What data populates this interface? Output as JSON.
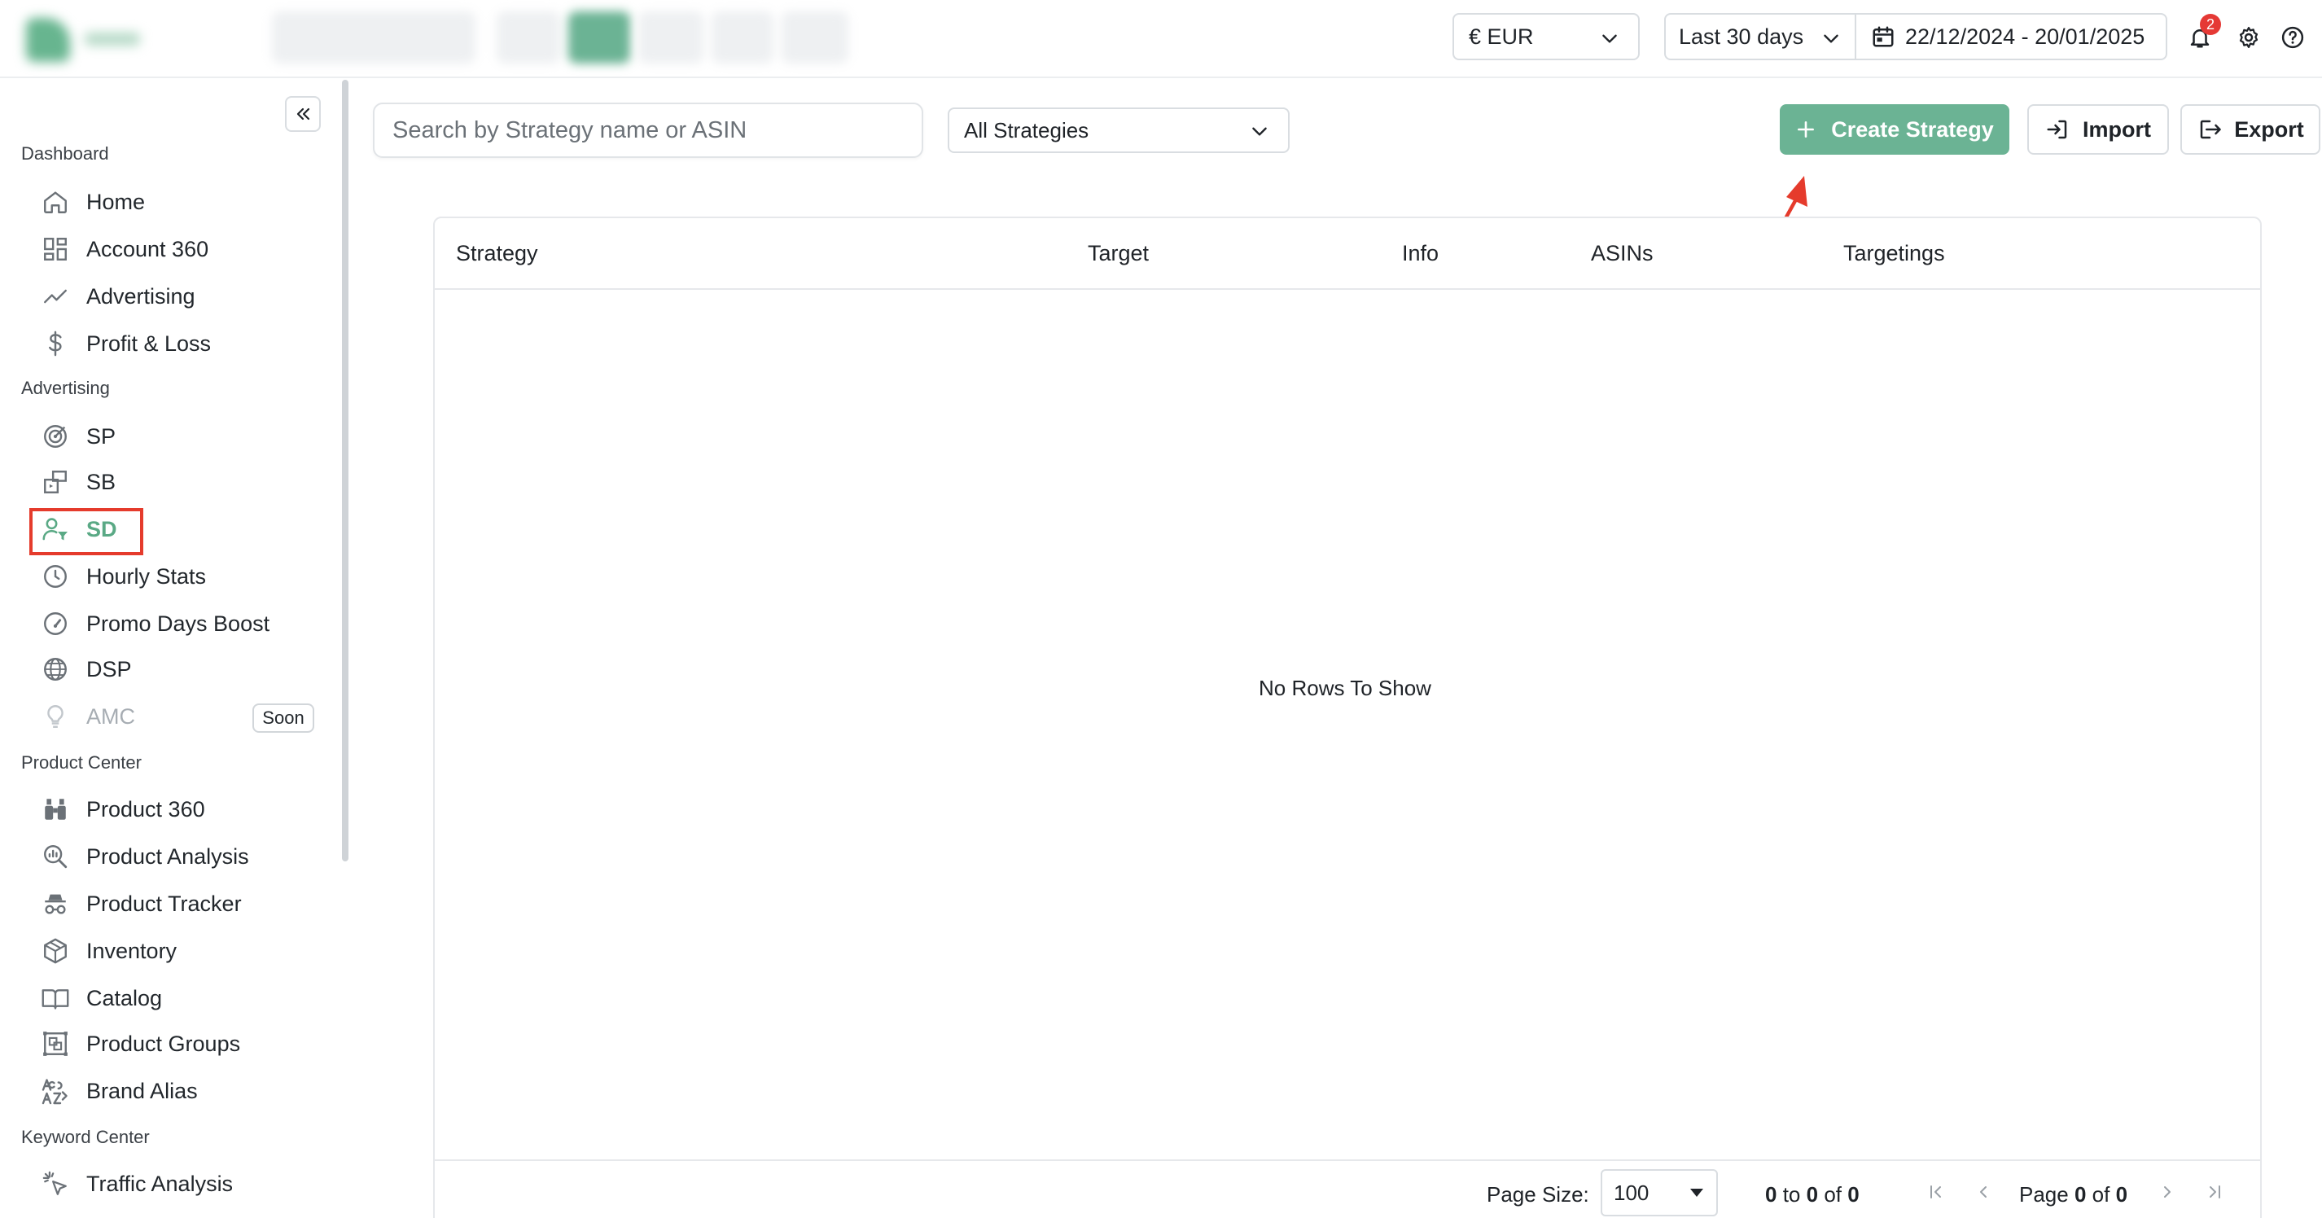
{
  "topbar": {
    "currency": "€ EUR",
    "date_range_preset": "Last 30 days",
    "date_range": "22/12/2024 - 20/01/2025",
    "notification_count": "2"
  },
  "sidebar": {
    "sections": [
      {
        "title": "Dashboard",
        "items": [
          {
            "label": "Home",
            "icon": "home-icon"
          },
          {
            "label": "Account 360",
            "icon": "dashboard-grid-icon"
          },
          {
            "label": "Advertising",
            "icon": "trend-line-icon"
          },
          {
            "label": "Profit & Loss",
            "icon": "dollar-icon"
          }
        ]
      },
      {
        "title": "Advertising",
        "items": [
          {
            "label": "SP",
            "icon": "target-icon"
          },
          {
            "label": "SB",
            "icon": "brand-banner-icon"
          },
          {
            "label": "SD",
            "icon": "user-filter-icon",
            "active": true
          },
          {
            "label": "Hourly Stats",
            "icon": "clock-icon"
          },
          {
            "label": "Promo Days Boost",
            "icon": "gauge-icon"
          },
          {
            "label": "DSP",
            "icon": "globe-icon"
          },
          {
            "label": "AMC",
            "icon": "lightbulb-icon",
            "disabled": true,
            "badge": "Soon"
          }
        ]
      },
      {
        "title": "Product Center",
        "items": [
          {
            "label": "Product 360",
            "icon": "binoculars-icon"
          },
          {
            "label": "Product Analysis",
            "icon": "magnifier-chart-icon"
          },
          {
            "label": "Product Tracker",
            "icon": "spy-icon"
          },
          {
            "label": "Inventory",
            "icon": "box-icon"
          },
          {
            "label": "Catalog",
            "icon": "book-icon"
          },
          {
            "label": "Product Groups",
            "icon": "group-icon"
          },
          {
            "label": "Brand Alias",
            "icon": "text-alias-icon"
          }
        ]
      },
      {
        "title": "Keyword Center",
        "items": [
          {
            "label": "Traffic Analysis",
            "icon": "sparkle-cursor-icon"
          }
        ]
      }
    ]
  },
  "toolbar": {
    "search_placeholder": "Search by Strategy name or ASIN",
    "strategy_filter": "All Strategies",
    "create_label": "Create Strategy",
    "import_label": "Import",
    "export_label": "Export"
  },
  "grid": {
    "columns": [
      "Strategy",
      "Target",
      "Info",
      "ASINs",
      "Targetings"
    ],
    "empty_message": "No Rows To Show",
    "footer": {
      "page_size_label": "Page Size:",
      "page_size": "100",
      "range_from": "0",
      "range_to_label": "to",
      "range_to": "0",
      "range_of_label": "of",
      "range_total": "0",
      "page_label": "Page",
      "page_current": "0",
      "page_of_label": "of",
      "page_total": "0"
    }
  },
  "colors": {
    "accent": "#6bb394",
    "active_nav": "#5aa985",
    "highlight": "#e53b2c"
  }
}
